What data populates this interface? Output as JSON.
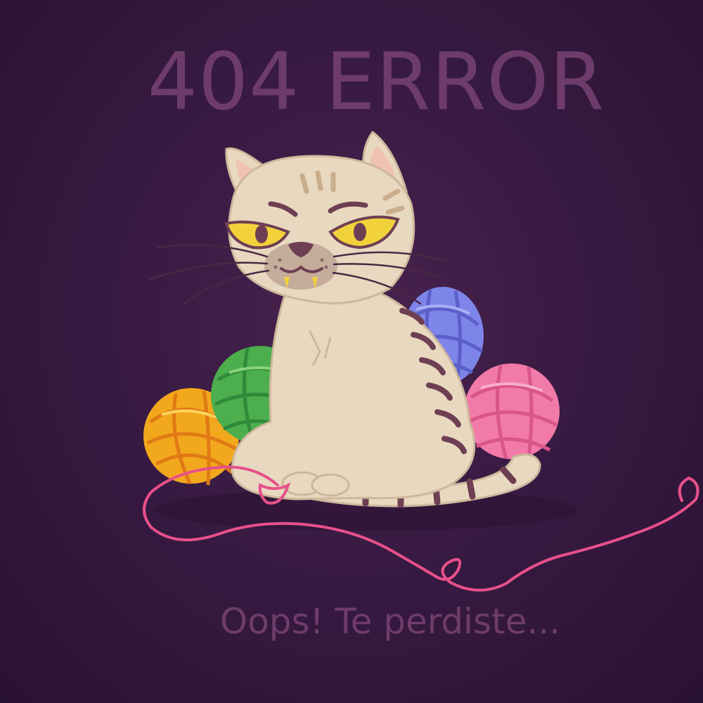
{
  "error_page": {
    "title": "404 ERROR",
    "message": "Oops! Te perdiste..."
  },
  "illustration": {
    "subject": "grumpy cat sitting with balls of yarn",
    "icons": [
      "cat-icon",
      "yarn-ball-icon"
    ]
  },
  "colors": {
    "background": "#381a42",
    "text": "#6e3c6a",
    "cat_fur": "#e8d8c0",
    "cat_stripes": "#6e3f52",
    "cat_eyes": "#f2d23a",
    "yarn_yellow": "#f2a81d",
    "yarn_green": "#4cae4c",
    "yarn_blue": "#7d86e8",
    "yarn_pink": "#f27aa8",
    "yarn_thread": "#e8508a"
  }
}
